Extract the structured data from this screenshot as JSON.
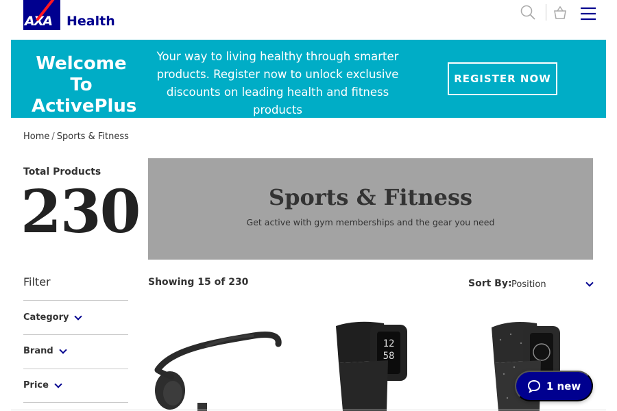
{
  "header": {
    "logo_text": "AXA",
    "brand": "Health",
    "icons": [
      "search-icon",
      "basket-icon",
      "menu-icon"
    ]
  },
  "banner": {
    "title": "Welcome To ActivePlus",
    "text": "Your way to living healthy through smarter products. Register now to unlock exclusive discounts on leading health and fitness products",
    "cta": "REGISTER NOW"
  },
  "breadcrumb": {
    "home": "Home",
    "separator": "/",
    "current": "Sports & Fitness"
  },
  "totals": {
    "label": "Total Products",
    "count": "230"
  },
  "hero": {
    "title": "Sports & Fitness",
    "subtitle": "Get active with gym memberships and the gear you need"
  },
  "filters": {
    "title": "Filter",
    "items": [
      {
        "label": "Category"
      },
      {
        "label": "Brand"
      },
      {
        "label": "Price"
      }
    ]
  },
  "results": {
    "showing": "Showing 15 of 230",
    "sort_label": "Sort By:",
    "sort_value": "Position"
  },
  "products": [
    {
      "name": "bone-conduction-headphones"
    },
    {
      "name": "fitness-tracker-black"
    },
    {
      "name": "fitness-tracker-speckled"
    }
  ],
  "tracker_time": {
    "hours": "12",
    "minutes": "58"
  },
  "chat": {
    "label": "1 new"
  },
  "colors": {
    "brand_blue": "#00008f",
    "banner_teal": "#00adc6",
    "hero_grey": "#a3a3a3",
    "axa_red": "#ff1721"
  }
}
